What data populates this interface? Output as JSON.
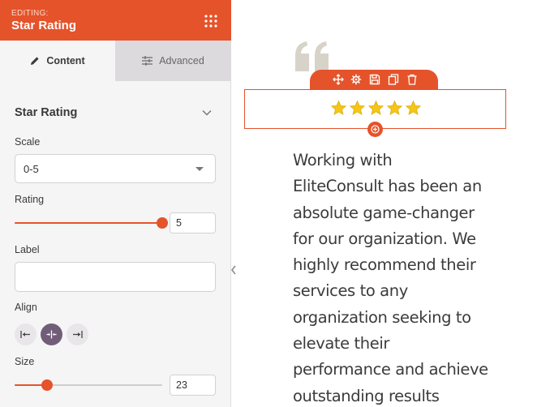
{
  "panel": {
    "editing_label": "EDITING:",
    "title": "Star Rating",
    "menu_icon": "grid-dots-icon",
    "accent_color": "#e5532a"
  },
  "tabs": [
    {
      "label": "Content",
      "icon": "pencil-icon",
      "active": true
    },
    {
      "label": "Advanced",
      "icon": "sliders-icon",
      "active": false
    }
  ],
  "section": {
    "title": "Star Rating",
    "expanded": true
  },
  "fields": {
    "scale": {
      "label": "Scale",
      "value": "0-5"
    },
    "rating": {
      "label": "Rating",
      "value": "5",
      "fraction": 1.0
    },
    "label": {
      "label": "Label",
      "value": ""
    },
    "align": {
      "label": "Align",
      "options": [
        "left",
        "center",
        "right"
      ],
      "selected": "center"
    },
    "size": {
      "label": "Size",
      "value": "23",
      "fraction": 0.22
    }
  },
  "preview": {
    "star_count": 5,
    "star_color": "#f5c518",
    "toolbar_icons": [
      "move-icon",
      "settings-icon",
      "save-icon",
      "duplicate-icon",
      "delete-icon"
    ],
    "quote_lines": [
      "Working with",
      "EliteConsult has been an",
      "absolute game-changer",
      "for our organization. We",
      "highly recommend their",
      "services to any",
      "organization seeking to",
      "elevate their",
      "performance and achieve",
      "outstanding results"
    ]
  }
}
